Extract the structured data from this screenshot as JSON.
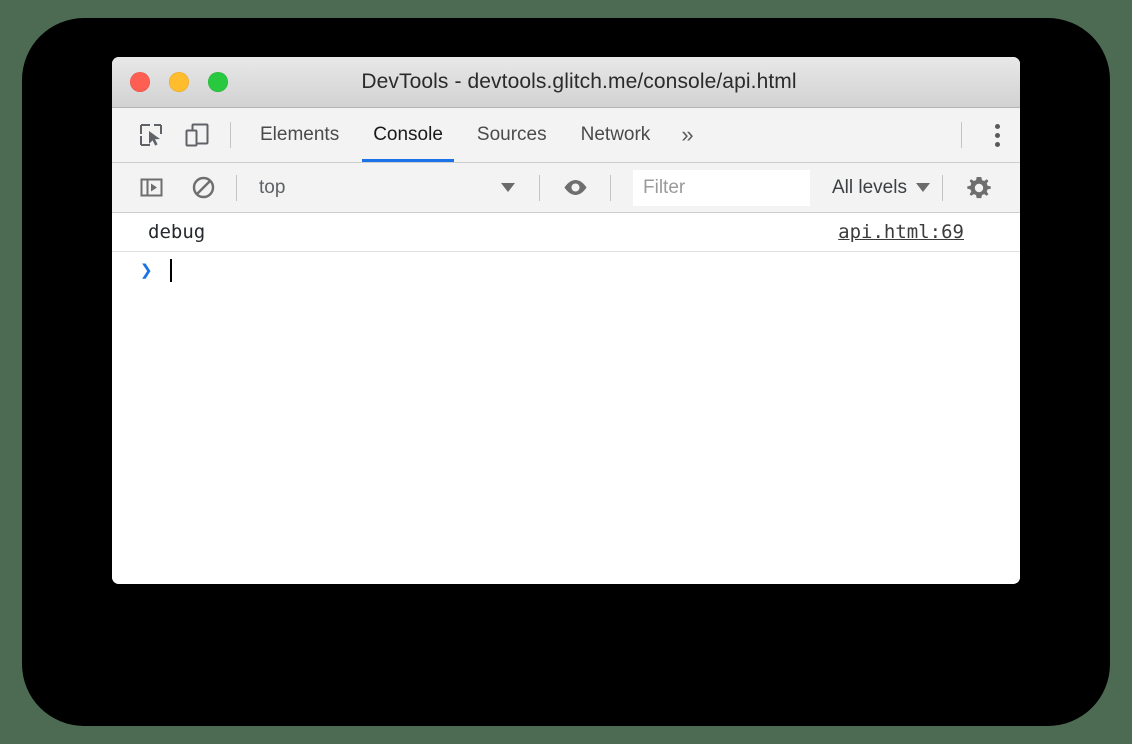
{
  "window": {
    "title": "DevTools - devtools.glitch.me/console/api.html",
    "traffic_lights": [
      {
        "name": "close",
        "color": "#ff5f52"
      },
      {
        "name": "minimize",
        "color": "#ffbd2e"
      },
      {
        "name": "maximize",
        "color": "#28c93f"
      }
    ]
  },
  "tab_bar": {
    "inspect_icon": "inspect-element-icon",
    "device_icon": "device-toolbar-icon",
    "tabs": [
      {
        "label": "Elements",
        "active": false
      },
      {
        "label": "Console",
        "active": true
      },
      {
        "label": "Sources",
        "active": false
      },
      {
        "label": "Network",
        "active": false
      }
    ],
    "overflow_label": "»",
    "kebab_icon": "more-options-icon",
    "active_underline_color": "#1a73e8"
  },
  "console_toolbar": {
    "sidebar_toggle_icon": "console-sidebar-icon",
    "clear_icon": "clear-console-icon",
    "context": {
      "label": "top",
      "caret_icon": "chevron-down-icon"
    },
    "eye_icon": "create-live-expression-icon",
    "filter": {
      "value": "",
      "placeholder": "Filter"
    },
    "levels": {
      "label": "All levels",
      "caret_icon": "chevron-down-icon"
    },
    "settings_icon": "gear-icon"
  },
  "console": {
    "messages": [
      {
        "text": "debug",
        "source": "api.html:69"
      }
    ],
    "prompt": {
      "chevron": "❯",
      "input_value": "",
      "chevron_color": "#1a73e8"
    }
  },
  "theme": {
    "backdrop_green": "#4d6b52",
    "panel_black": "#000000",
    "window_white": "#ffffff",
    "toolbar_gray": "#f3f3f3"
  }
}
